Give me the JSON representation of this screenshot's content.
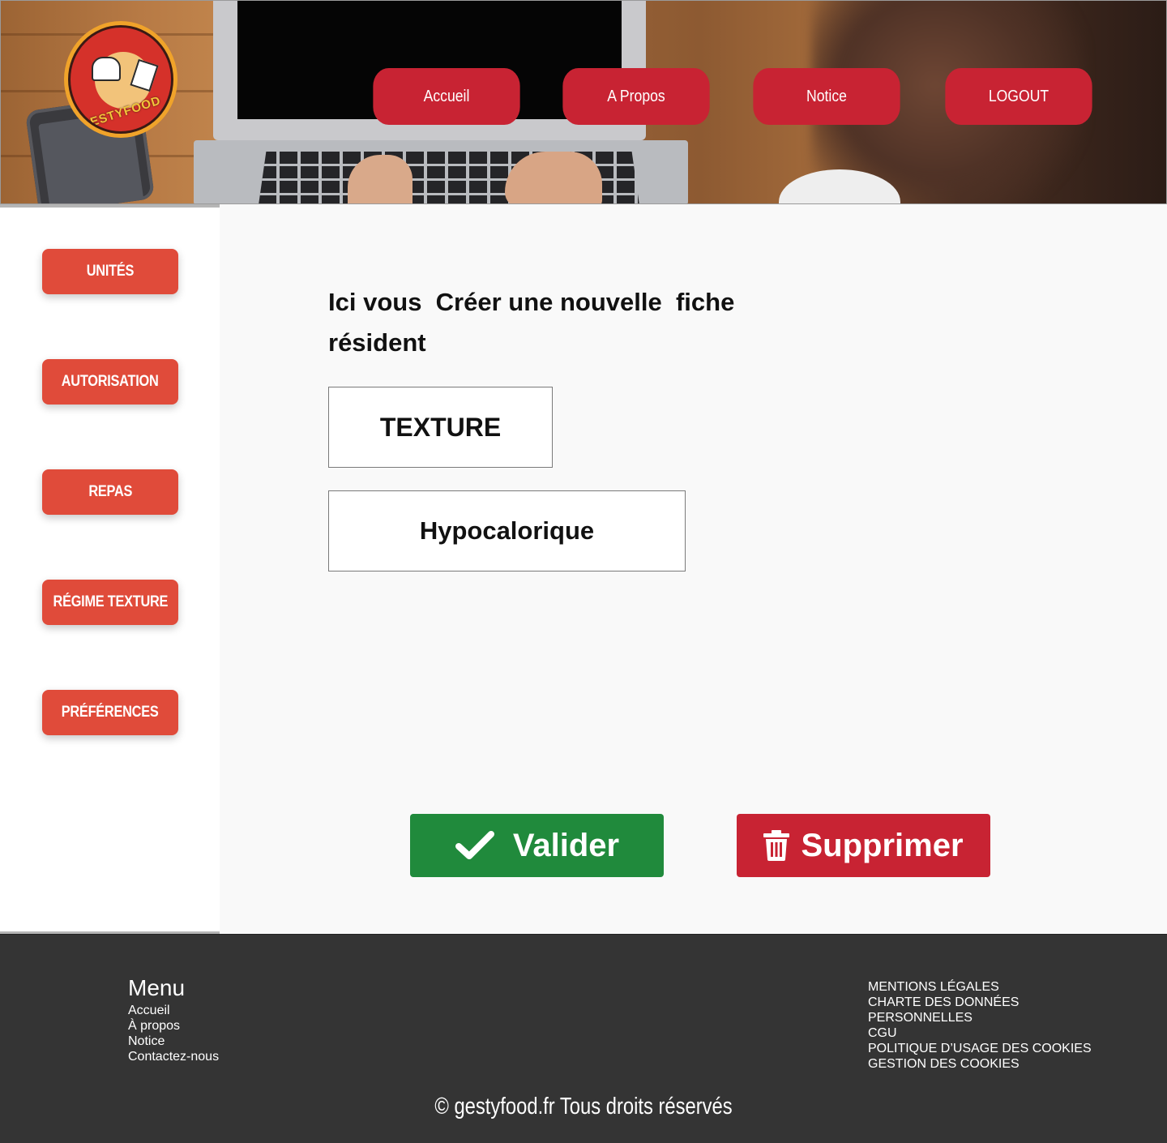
{
  "header": {
    "logo_text": "GESTYFOOD",
    "nav": [
      {
        "label": "Accueil"
      },
      {
        "label": "A Propos"
      },
      {
        "label": "Notice"
      },
      {
        "label": "LOGOUT"
      }
    ]
  },
  "sidebar": {
    "items": [
      {
        "label": "UNITÉS"
      },
      {
        "label": "AUTORISATION"
      },
      {
        "label": "REPAS"
      },
      {
        "label": "RÉGIME TEXTURE"
      },
      {
        "label": "PRÉFÉRENCES"
      }
    ]
  },
  "main": {
    "heading": "Ici vous  Créer une nouvelle  fiche résident",
    "fields": [
      {
        "value": "TEXTURE"
      },
      {
        "value": "Hypocalorique"
      }
    ],
    "actions": {
      "validate_label": "Valider",
      "validate_icon": "check-icon",
      "delete_label": "Supprimer",
      "delete_icon": "trash-icon"
    }
  },
  "footer": {
    "menu_title": "Menu",
    "menu_items": [
      "Accueil",
      "À propos",
      "Notice",
      "Contactez-nous"
    ],
    "legal_items": [
      "MENTIONS LÉGALES",
      "CHARTE DES DONNÉES",
      "PERSONNELLES",
      "CGU",
      "POLITIQUE D’USAGE DES COOKIES",
      "GESTION DES COOKIES"
    ],
    "copyright": "© gestyfood.fr  Tous droits réservés"
  },
  "colors": {
    "nav_button": "#c82333",
    "sidebar_button": "#e04b3a",
    "validate": "#208a3c",
    "delete": "#c82333",
    "footer_bg": "#343434"
  }
}
